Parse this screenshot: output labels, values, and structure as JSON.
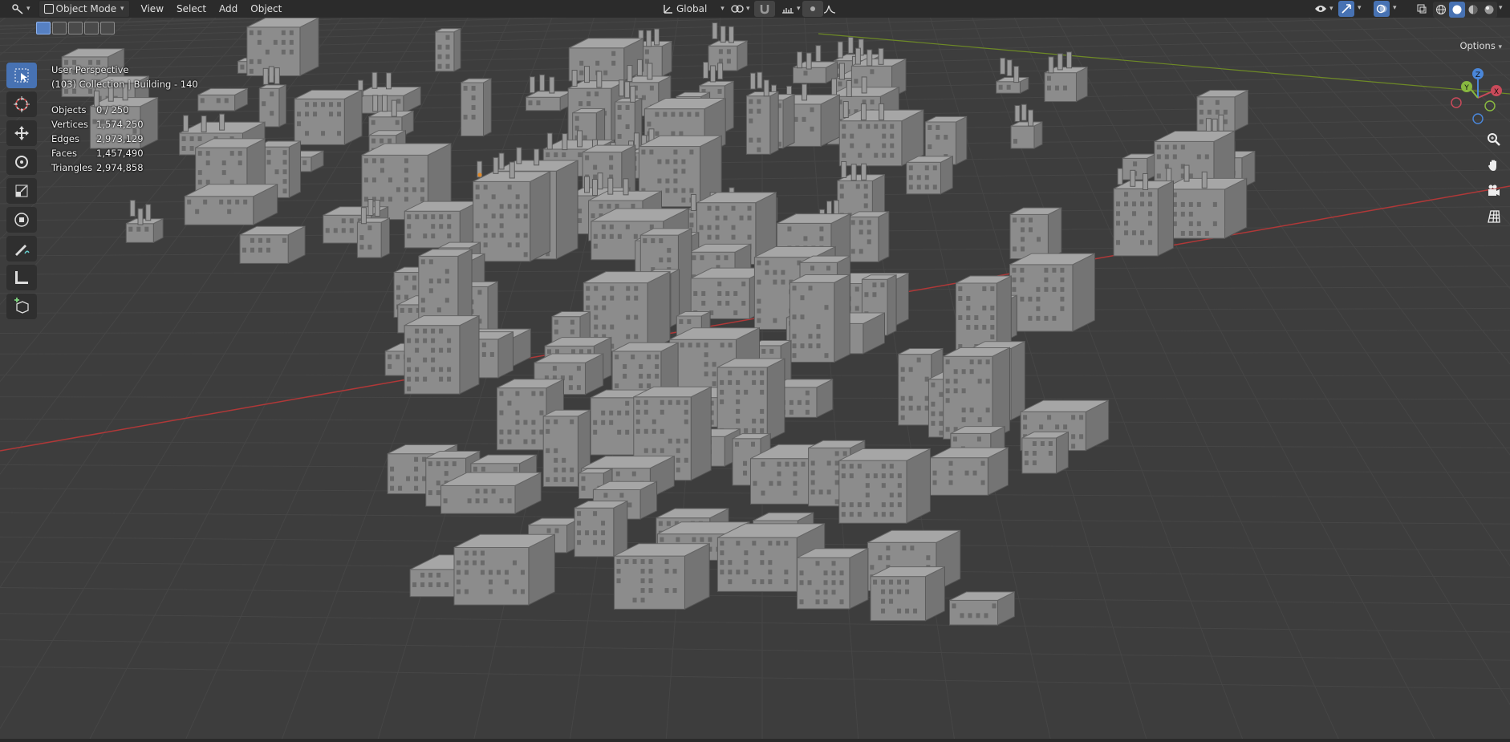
{
  "header": {
    "mode": "Object Mode",
    "menus": [
      "View",
      "Select",
      "Add",
      "Object"
    ],
    "orientation": "Global"
  },
  "viewport": {
    "view_name": "User Perspective",
    "collection_info": "(103) Collection | Building - 140",
    "stats": [
      {
        "label": "Objects",
        "value": "0 / 250"
      },
      {
        "label": "Vertices",
        "value": "1,574,250"
      },
      {
        "label": "Edges",
        "value": "2,973,129"
      },
      {
        "label": "Faces",
        "value": "1,457,490"
      },
      {
        "label": "Triangles",
        "value": "2,974,858"
      }
    ],
    "options_label": "Options",
    "gizmo_labels": {
      "x": "X",
      "y": "Y",
      "z": "Z"
    }
  },
  "colors": {
    "header_bg": "#2b2b2b",
    "viewport_bg": "#3d3d3d",
    "grid_line": "#464646",
    "x_axis": "#b83a3a",
    "y_axis": "#7a9a2a",
    "accent": "#4772b3",
    "building": "#8e8e8e"
  },
  "icons": {
    "editor_type": "editor-type-icon",
    "select_box": "select-box-icon",
    "cursor": "cursor-icon",
    "move": "move-icon",
    "rotate": "rotate-icon",
    "scale": "scale-icon",
    "transform": "transform-icon",
    "annotate": "annotate-icon",
    "measure": "measure-icon",
    "add_cube": "add-cube-icon",
    "zoom": "zoom-icon",
    "pan": "hand-pan-icon",
    "camera": "camera-icon",
    "ortho": "grid-ortho-icon"
  }
}
